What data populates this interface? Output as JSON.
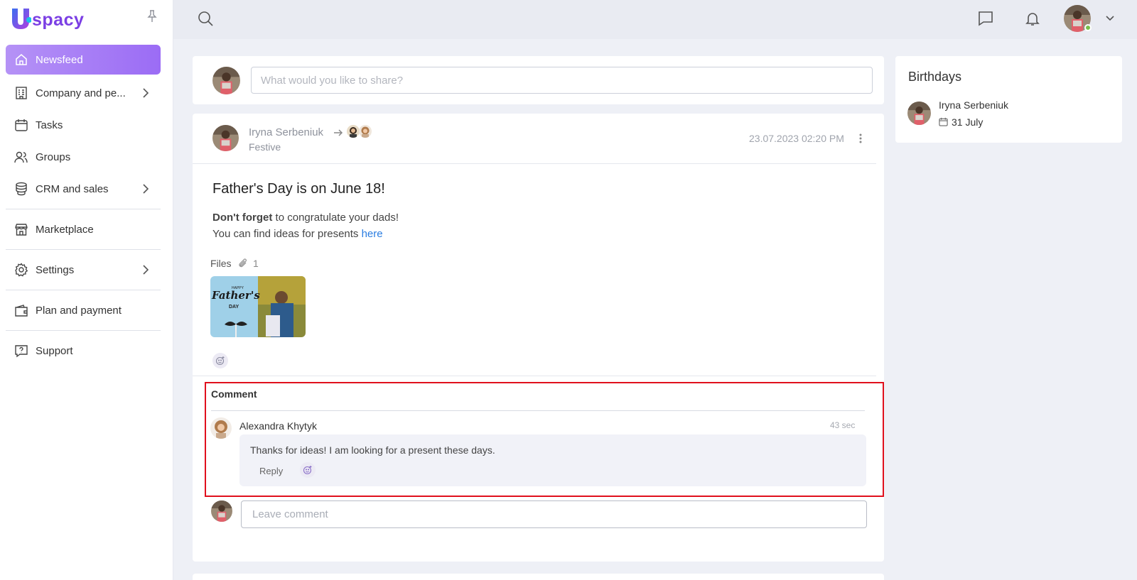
{
  "app": {
    "brand": "spacy",
    "brand_letter": "U"
  },
  "sidebar": {
    "items": [
      {
        "label": "Newsfeed",
        "icon": "home-icon"
      },
      {
        "label": "Company and pe...",
        "icon": "building-icon"
      },
      {
        "label": "Tasks",
        "icon": "calendar-icon"
      },
      {
        "label": "Groups",
        "icon": "users-icon"
      },
      {
        "label": "CRM and sales",
        "icon": "coins-icon"
      },
      {
        "label": "Marketplace",
        "icon": "store-icon"
      },
      {
        "label": "Settings",
        "icon": "gear-icon"
      },
      {
        "label": "Plan and payment",
        "icon": "wallet-icon"
      },
      {
        "label": "Support",
        "icon": "help-icon"
      }
    ]
  },
  "share": {
    "placeholder": "What would you like to share?"
  },
  "post": {
    "author": "Iryna Serbeniuk",
    "category": "Festive",
    "timestamp": "23.07.2023 02:20 PM",
    "title": "Father's Day is on June 18!",
    "bold_text": "Don't forget",
    "text_rest": " to congratulate your dads!",
    "line2": "You can find ideas for presents ",
    "link": "here",
    "files_label": "Files",
    "files_count": "1",
    "image_text": {
      "happy": "HAPPY",
      "fathers": "Father's",
      "day": "DAY"
    }
  },
  "comments": {
    "heading": "Comment",
    "items": [
      {
        "author": "Alexandra Khytyk",
        "time": "43 sec",
        "text": "Thanks for ideas! I am looking for a present these days.",
        "reply_label": "Reply"
      }
    ],
    "input_placeholder": "Leave comment"
  },
  "birthdays": {
    "title": "Birthdays",
    "person": "Iryna Serbeniuk",
    "date": "31 July"
  },
  "colors": {
    "accent": "#9b6cf5",
    "link": "#2a7de1",
    "highlight_border": "#e0101d",
    "online": "#78c04b"
  }
}
